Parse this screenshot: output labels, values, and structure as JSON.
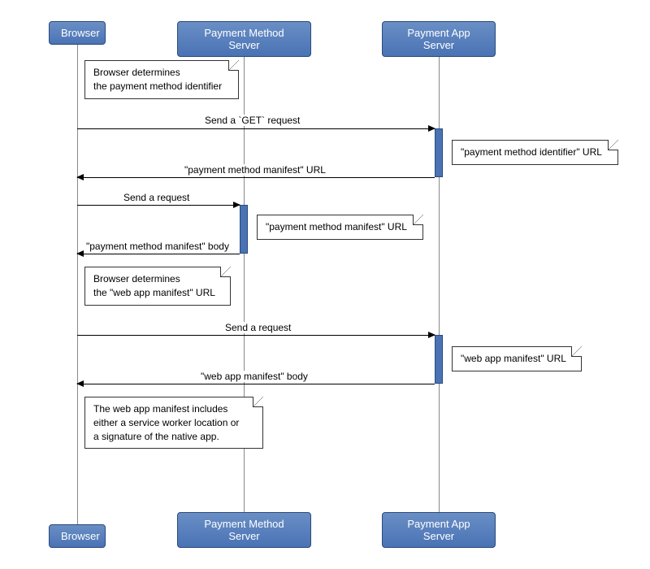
{
  "participants": {
    "browser": "Browser",
    "pms": "Payment Method Server",
    "pas": "Payment App Server"
  },
  "notes": {
    "n1a": "Browser determines",
    "n1b": "the payment method identifier",
    "n2": "\"payment method identifier\" URL",
    "n3": "\"payment method manifest\" URL",
    "n4a": "Browser determines",
    "n4b": "the \"web app manifest\" URL",
    "n5": "\"web app manifest\" URL",
    "n6a": "The web app manifest includes",
    "n6b": "either a service worker location or",
    "n6c": "a signature of the native app."
  },
  "messages": {
    "m1": "Send a `GET` request",
    "m2": "\"payment method manifest\" URL",
    "m3": "Send a request",
    "m4": "\"payment method manifest\" body",
    "m5": "Send a request",
    "m6": "\"web app manifest\" body"
  }
}
